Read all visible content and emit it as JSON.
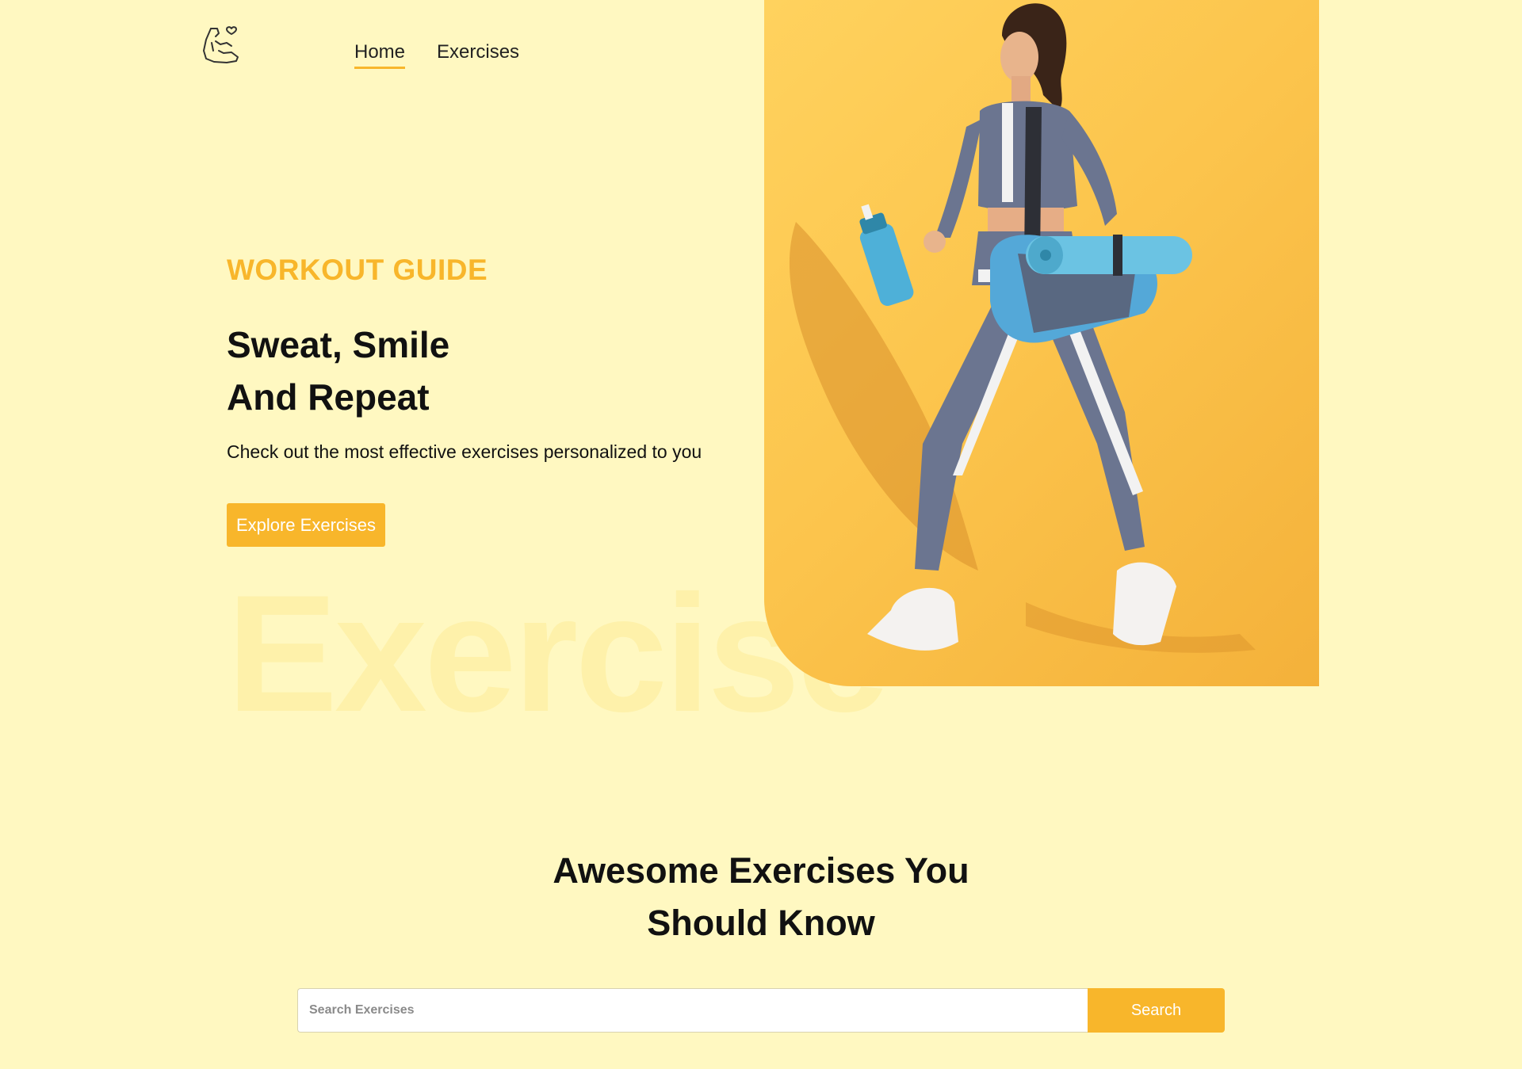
{
  "header": {
    "logo_icon": "flexed-arm-heart-icon",
    "nav": [
      {
        "label": "Home",
        "active": true
      },
      {
        "label": "Exercises",
        "active": false
      }
    ]
  },
  "hero": {
    "eyebrow": "WORKOUT GUIDE",
    "headline_line1": "Sweat, Smile",
    "headline_line2": "And Repeat",
    "subtext": "Check out the most effective exercises personalized to you",
    "cta_label": "Explore Exercises",
    "watermark": "Exercise",
    "image_icon": "woman-walking-with-gym-bag"
  },
  "exercises_section": {
    "title_line1": "Awesome Exercises You",
    "title_line2": "Should Know",
    "search_placeholder": "Search Exercises",
    "search_value": "",
    "search_button_label": "Search"
  },
  "colors": {
    "background": "#fff8c1",
    "accent": "#f8b62b",
    "text": "#111111"
  }
}
